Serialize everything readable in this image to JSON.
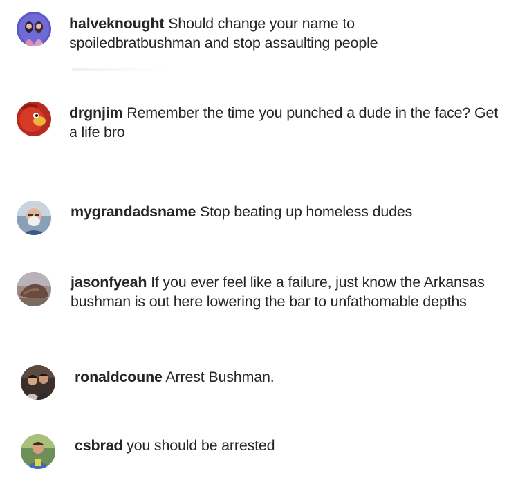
{
  "comments": [
    {
      "username": "halveknought",
      "text": "Should change your name to spoiledbratbushman and stop assaulting people",
      "avatar_icon": "profile-photo-two-people-icon"
    },
    {
      "username": "drgnjim",
      "text": "Remember the time you punched a dude in the face? Get a life bro",
      "avatar_icon": "profile-photo-red-cartoon-icon"
    },
    {
      "username": "mygrandadsname",
      "text": "Stop beating up homeless dudes",
      "avatar_icon": "profile-photo-older-man-icon"
    },
    {
      "username": "jasonfyeah",
      "text": "If you ever feel like a failure, just know the Arkansas bushman is out here lowering the bar to unfathomable depths",
      "avatar_icon": "profile-photo-rock-icon"
    },
    {
      "username": "ronaldcoune",
      "text": "Arrest Bushman.",
      "avatar_icon": "profile-photo-group-icon"
    },
    {
      "username": "csbrad",
      "text": "you should be arrested",
      "avatar_icon": "profile-photo-outdoor-person-icon"
    }
  ]
}
